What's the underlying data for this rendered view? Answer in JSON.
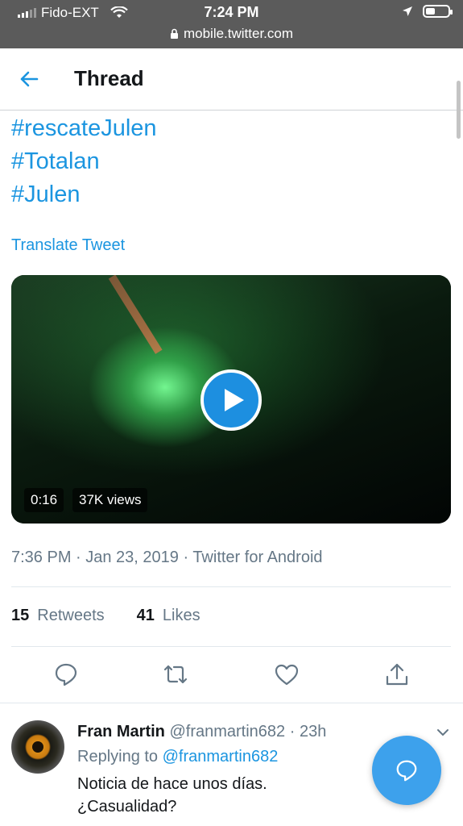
{
  "status_bar": {
    "carrier": "Fido-EXT",
    "time": "7:24 PM",
    "url": "mobile.twitter.com"
  },
  "header": {
    "title": "Thread"
  },
  "tweet": {
    "hashtags": [
      "#rescateJulen",
      "#Totalan",
      "#Julen"
    ],
    "translate_label": "Translate Tweet",
    "video": {
      "duration": "0:16",
      "views": "37K views"
    },
    "meta": "7:36 PM · Jan 23, 2019 · Twitter for Android",
    "stats": {
      "retweets_count": "15",
      "retweets_label": "Retweets",
      "likes_count": "41",
      "likes_label": "Likes"
    }
  },
  "reply": {
    "name": "Fran Martin",
    "handle_time": "@franmartin682 · 23h",
    "replying_prefix": "Replying to",
    "replying_handle": "@franmartin682",
    "text_line1": "Noticia de hace unos días.",
    "text_line2": "¿Casualidad?"
  },
  "icons": {
    "accent": "#1b95e0"
  }
}
